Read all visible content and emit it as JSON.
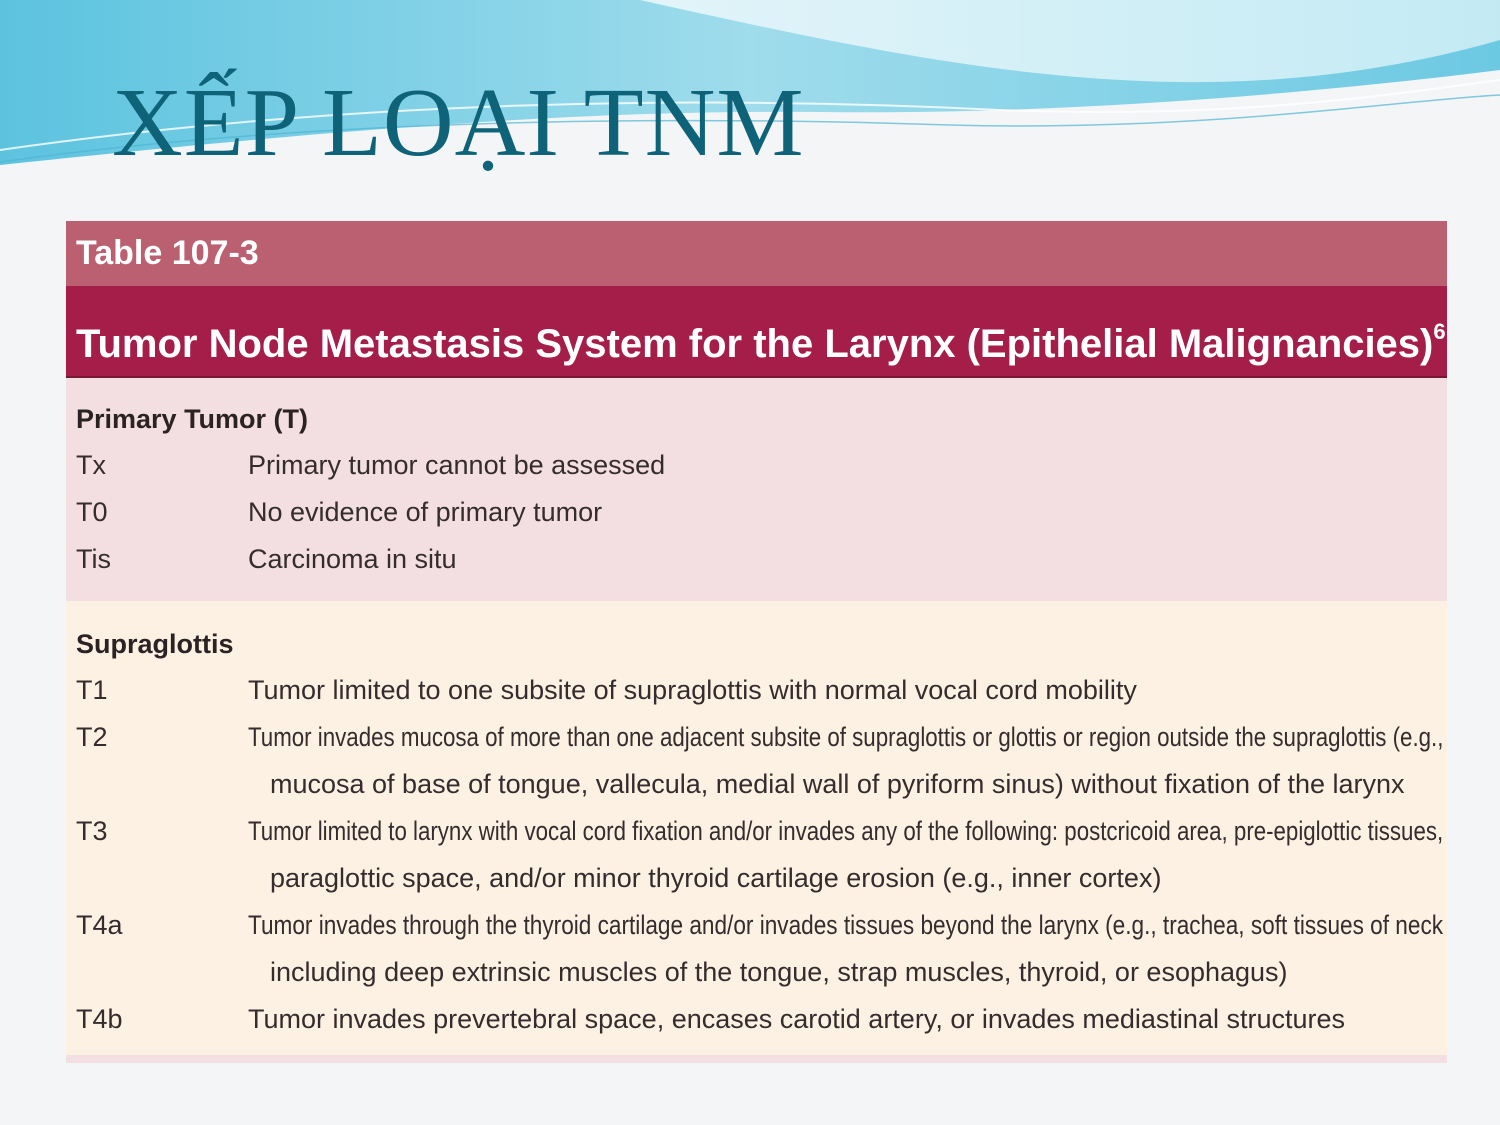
{
  "slide": {
    "title": "XẾP LOẠI TNM",
    "title_color": "#0f6378"
  },
  "table": {
    "label": "Table 107-3",
    "title": "Tumor Node Metastasis System for the Larynx (Epithelial Malignancies)",
    "title_superscript": "6",
    "colors": {
      "label_bar": "#bb6070",
      "title_bar": "#a51e4a",
      "primary_bg": "#f3dfe2",
      "supra_bg": "#fdf1e3"
    },
    "primary_tumor": {
      "heading": "Primary Tumor (T)",
      "rows": [
        {
          "code": "Tx",
          "desc": [
            "Primary tumor cannot be assessed"
          ]
        },
        {
          "code": "T0",
          "desc": [
            "No evidence of primary tumor"
          ]
        },
        {
          "code": "Tis",
          "desc": [
            "Carcinoma in situ"
          ]
        }
      ]
    },
    "supraglottis": {
      "heading": "Supraglottis",
      "rows": [
        {
          "code": "T1",
          "desc": [
            "Tumor limited to one subsite of supraglottis with normal vocal cord mobility"
          ]
        },
        {
          "code": "T2",
          "desc": [
            "Tumor invades mucosa of more than one adjacent subsite of supraglottis or glottis or region outside the supraglottis (e.g.,",
            "mucosa of base of tongue, vallecula, medial wall of pyriform sinus) without fixation of the larynx"
          ]
        },
        {
          "code": "T3",
          "desc": [
            "Tumor limited to larynx with vocal cord fixation and/or invades any of the following: postcricoid area, pre-epiglottic tissues,",
            "paraglottic space, and/or minor thyroid cartilage erosion (e.g., inner cortex)"
          ]
        },
        {
          "code": "T4a",
          "desc": [
            "Tumor invades through the thyroid cartilage and/or invades tissues beyond the larynx (e.g., trachea, soft tissues of neck",
            "including deep extrinsic muscles of the tongue, strap muscles, thyroid, or esophagus)"
          ]
        },
        {
          "code": "T4b",
          "desc": [
            "Tumor invades prevertebral space, encases carotid artery, or invades mediastinal structures"
          ]
        }
      ]
    }
  }
}
